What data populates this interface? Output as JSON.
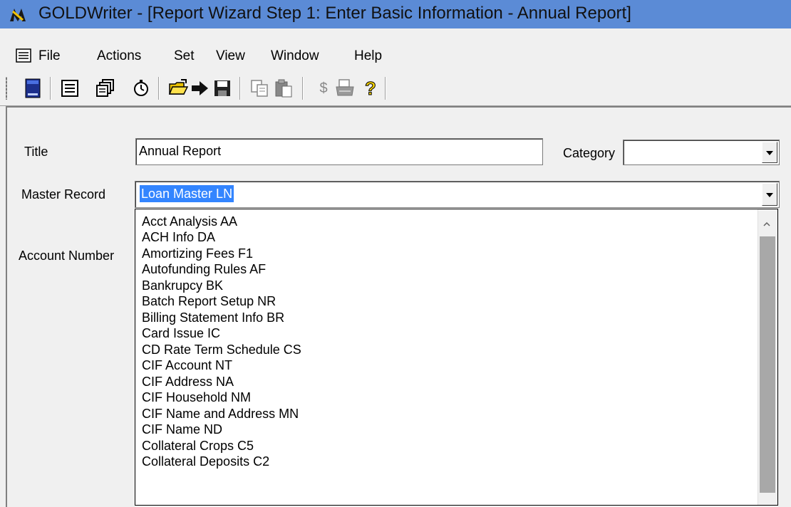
{
  "window": {
    "title": "GOLDWriter - [Report Wizard Step 1:  Enter Basic Information - Annual Report]"
  },
  "menu": {
    "items": [
      "File",
      "Actions",
      "Set",
      "View",
      "Window",
      "Help"
    ]
  },
  "toolbar": {
    "buttons": [
      "calculator-icon",
      "report-icon",
      "reports-stack-icon",
      "timer-icon",
      "open-folder-icon",
      "run-arrow-icon",
      "save-icon",
      "copy-icon",
      "paste-icon",
      "dollar-icon",
      "print-icon",
      "help-icon"
    ],
    "dollar_label": "$",
    "help_label": "?"
  },
  "form": {
    "title_label": "Title",
    "title_value": "Annual Report",
    "category_label": "Category",
    "category_value": "",
    "master_record_label": "Master Record",
    "master_record_value": "Loan Master LN",
    "account_number_label": "Account Number"
  },
  "dropdown": {
    "options": [
      "Acct Analysis AA",
      "ACH Info DA",
      "Amortizing Fees F1",
      "Autofunding Rules AF",
      "Bankrupcy BK",
      "Batch Report Setup NR",
      "Billing Statement Info BR",
      "Card Issue IC",
      "CD Rate Term Schedule CS",
      "CIF Account NT",
      "CIF Address NA",
      "CIF Household NM",
      "CIF Name and Address MN",
      "CIF Name ND",
      "Collateral Crops C5",
      "Collateral Deposits C2"
    ]
  },
  "colors": {
    "titlebar": "#5b8bd6",
    "selection": "#3385ff"
  }
}
